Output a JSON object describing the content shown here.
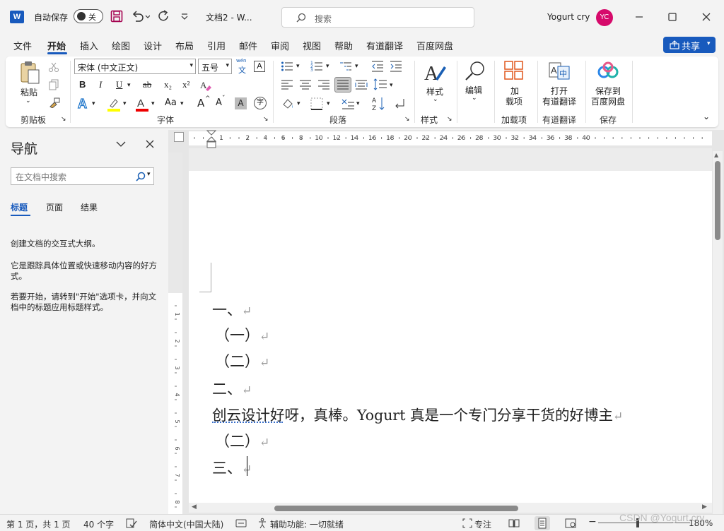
{
  "titlebar": {
    "app_icon": "W",
    "autosave_label": "自动保存",
    "autosave_state": "关",
    "doc_title": "文档2 - W...",
    "search_placeholder": "搜索",
    "user_name": "Yogurt cry",
    "user_initials": "YC",
    "icons": [
      "save-icon",
      "undo-icon",
      "redo-icon",
      "customize-quick-access-icon",
      "minimize-icon",
      "maximize-icon",
      "close-icon"
    ]
  },
  "menu": {
    "tabs": [
      "文件",
      "开始",
      "插入",
      "绘图",
      "设计",
      "布局",
      "引用",
      "邮件",
      "审阅",
      "视图",
      "帮助",
      "有道翻译",
      "百度网盘"
    ],
    "active_tab": "开始",
    "share_label": "共享"
  },
  "ribbon": {
    "clipboard": {
      "paste": "粘贴",
      "group": "剪贴板"
    },
    "font": {
      "font_name": "宋体 (中文正文)",
      "font_size": "五号",
      "phonetic": "wén",
      "bold": "B",
      "italic": "I",
      "underline": "U",
      "strike": "ab",
      "subscript": "x₂",
      "superscript": "x²",
      "change_case": "Aa",
      "grow": "A",
      "shrink": "A",
      "group": "字体"
    },
    "paragraph": {
      "group": "段落"
    },
    "styles": {
      "label": "样式",
      "group": "样式"
    },
    "editing": {
      "label": "编辑"
    },
    "addins": {
      "label1": "加",
      "label2": "载项",
      "group": "加载项"
    },
    "youdao": {
      "label1": "打开",
      "label2": "有道翻译",
      "group": "有道翻译"
    },
    "baidu": {
      "label1": "保存到",
      "label2": "百度网盘",
      "group": "保存"
    }
  },
  "nav": {
    "title": "导航",
    "search_placeholder": "在文档中搜索",
    "tabs": [
      "标题",
      "页面",
      "结果"
    ],
    "text1": "创建文档的交互式大纲。",
    "text2": "它是跟踪具体位置或快速移动内容的好方式。",
    "text3": "若要开始，请转到\"开始\"选项卡，并向文档中的标题应用标题样式。"
  },
  "ruler": {
    "h_ticks": [
      "1",
      "2",
      "4",
      "6",
      "8",
      "10",
      "12",
      "14",
      "16",
      "18",
      "20",
      "22",
      "24",
      "26",
      "28",
      "30",
      "32",
      "34",
      "36",
      "38",
      "40"
    ],
    "v_ticks": [
      "1",
      "2",
      "3",
      "4",
      "5",
      "6",
      "7",
      "8"
    ]
  },
  "document": {
    "lines": [
      "一、",
      "（一）",
      "（二）",
      "二、",
      "创云设计好呀，真棒。Yogurt 真是一个专门分享干货的好博主",
      "（二）",
      "三、"
    ],
    "return_mark": "↵"
  },
  "status": {
    "page": "第 1 页，共 1 页",
    "words": "40 个字",
    "language": "简体中文(中国大陆)",
    "accessibility": "辅助功能: 一切就绪",
    "focus": "专注",
    "zoom": "180%"
  },
  "watermark": "CSDN @Yogurt cry"
}
